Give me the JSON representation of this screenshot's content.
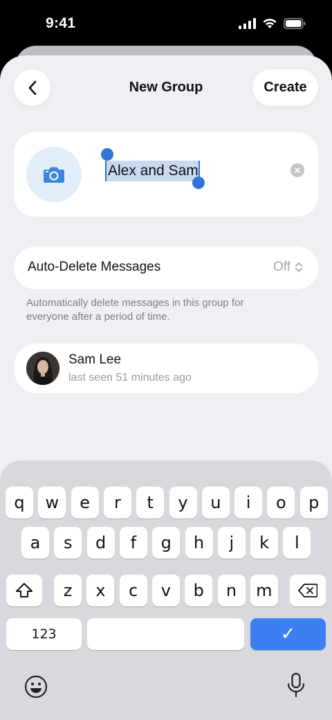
{
  "status_bar": {
    "time": "9:41"
  },
  "header": {
    "title": "New Group",
    "create_label": "Create"
  },
  "group": {
    "name": "Alex and Sam"
  },
  "auto_delete": {
    "label": "Auto-Delete Messages",
    "value": "Off",
    "note": "Automatically delete messages in this group for everyone after a period of time."
  },
  "members": [
    {
      "name": "Sam Lee",
      "status": "last seen 51 minutes ago"
    }
  ],
  "keyboard": {
    "row1": [
      "q",
      "w",
      "e",
      "r",
      "t",
      "y",
      "u",
      "i",
      "o",
      "p"
    ],
    "row2": [
      "a",
      "s",
      "d",
      "f",
      "g",
      "h",
      "j",
      "k",
      "l"
    ],
    "row3": [
      "z",
      "x",
      "c",
      "v",
      "b",
      "n",
      "m"
    ],
    "numbers_label": "123",
    "done_label": "✓"
  },
  "colors": {
    "accent": "#3173d6",
    "done_key": "#3d7ff0",
    "background": "#efeff4"
  },
  "icons": [
    "chevron-left-icon",
    "camera-icon",
    "clear-icon",
    "chevron-up-down-icon",
    "shift-icon",
    "backspace-icon",
    "emoji-icon",
    "microphone-icon",
    "signal-icon",
    "wifi-icon",
    "battery-icon"
  ]
}
